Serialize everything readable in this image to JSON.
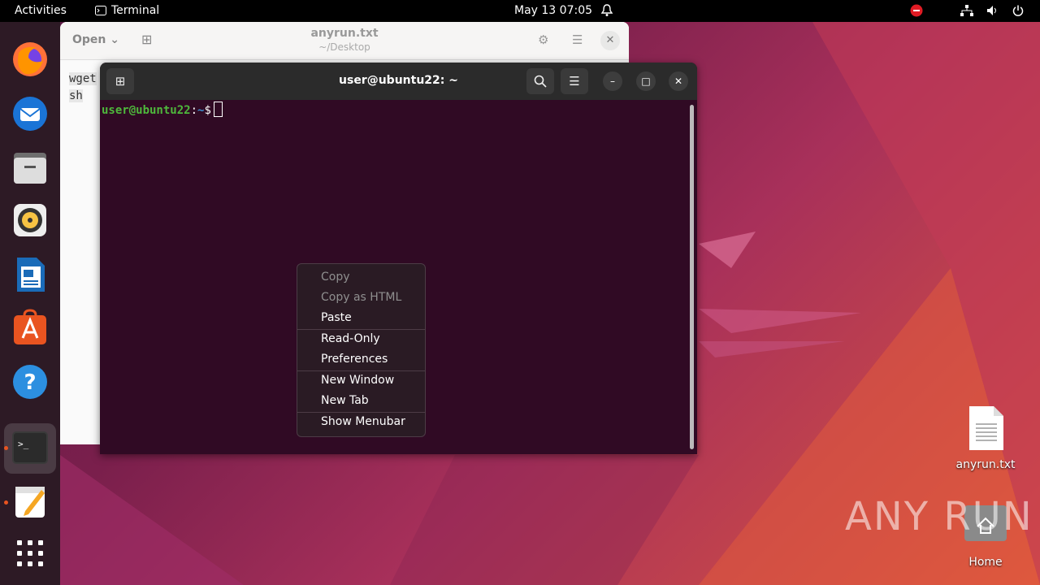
{
  "topbar": {
    "activities": "Activities",
    "app_name": "Terminal",
    "clock": "May 13  07:05"
  },
  "dock": {
    "items": [
      "firefox-icon",
      "thunderbird-icon",
      "files-icon",
      "rhythmbox-icon",
      "writer-icon",
      "app-center-icon",
      "help-icon",
      "terminal-icon",
      "text-editor-icon",
      "show-apps-icon"
    ]
  },
  "gedit": {
    "open_label": "Open",
    "title": "anyrun.txt",
    "subtitle": "~/Desktop",
    "lines": [
      "wget",
      "sh"
    ]
  },
  "terminal": {
    "title": "user@ubuntu22: ~",
    "prompt_user": "user@ubuntu22",
    "prompt_sep": ":",
    "prompt_path": "~",
    "prompt_symbol": "$"
  },
  "context_menu": {
    "copy": "Copy",
    "copy_html": "Copy as HTML",
    "paste": "Paste",
    "read_only": "Read-Only",
    "preferences": "Preferences",
    "new_window": "New Window",
    "new_tab": "New Tab",
    "show_menubar": "Show Menubar"
  },
  "desktop": {
    "file_label": "anyrun.txt",
    "home_label": "Home",
    "watermark": "ANY RUN"
  },
  "colors": {
    "accent": "#e95420",
    "terminal_bg": "#300a24",
    "prompt_user": "#4eb83c",
    "prompt_path": "#3f8fd0"
  }
}
